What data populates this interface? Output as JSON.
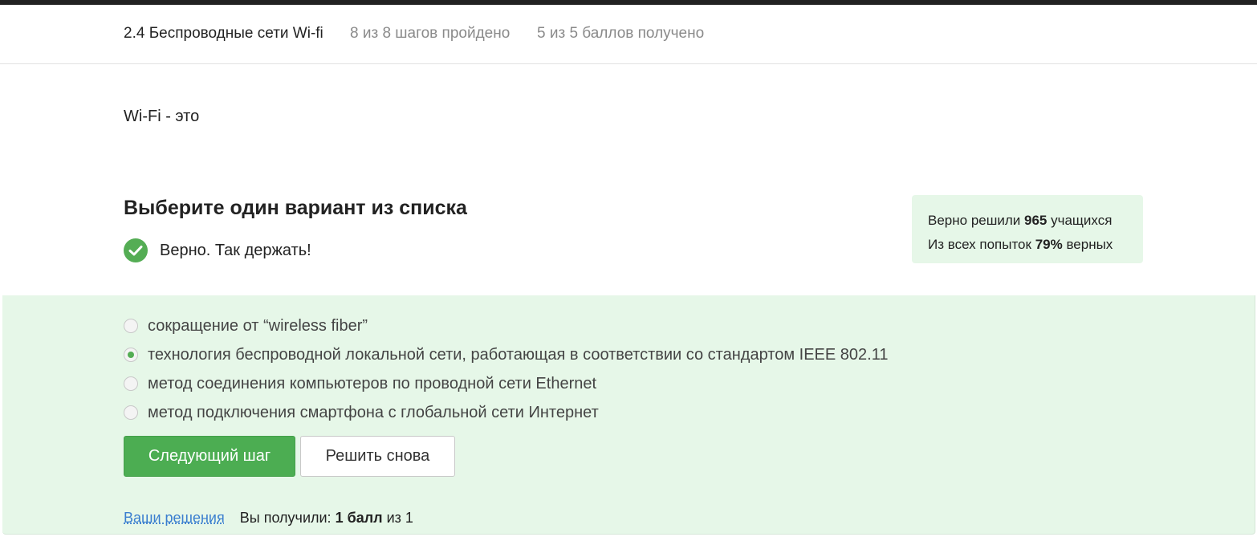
{
  "header": {
    "lesson_title": "2.4 Беспроводные сети Wi-fi",
    "steps_progress": "8 из 8 шагов пройдено",
    "points_progress": "5 из 5 баллов  получено"
  },
  "question": {
    "text": "Wi-Fi - это"
  },
  "quiz": {
    "heading": "Выберите один вариант из списка",
    "feedback": "Верно. Так держать!",
    "options": [
      {
        "label": "сокращение от “wireless fiber”",
        "selected": false
      },
      {
        "label": "технология беспроводной локальной сети, работающая в соответствии со стандартом IEEE 802.11",
        "selected": true
      },
      {
        "label": "метод соединения компьютеров по проводной сети Ethernet",
        "selected": false
      },
      {
        "label": "метод подключения смартфона с глобальной сети Интернет",
        "selected": false
      }
    ]
  },
  "stats": {
    "solved_prefix": "Верно решили",
    "solved_count": "965",
    "solved_suffix": "учащихся",
    "attempts_prefix": "Из всех попыток",
    "attempts_percent": "79%",
    "attempts_suffix": "верных"
  },
  "buttons": {
    "next_label": "Следующий шаг",
    "retry_label": "Решить снова"
  },
  "footer": {
    "solutions_link": "Ваши решения",
    "score_prefix": "Вы получили:",
    "score_value": "1 балл",
    "score_suffix": "из 1"
  },
  "colors": {
    "accent_green": "#4cad52",
    "panel_green": "#e6f7e8",
    "link_blue": "#3a7ecf"
  },
  "icons": {
    "feedback": "check-circle-icon",
    "option": "radio-icon"
  }
}
